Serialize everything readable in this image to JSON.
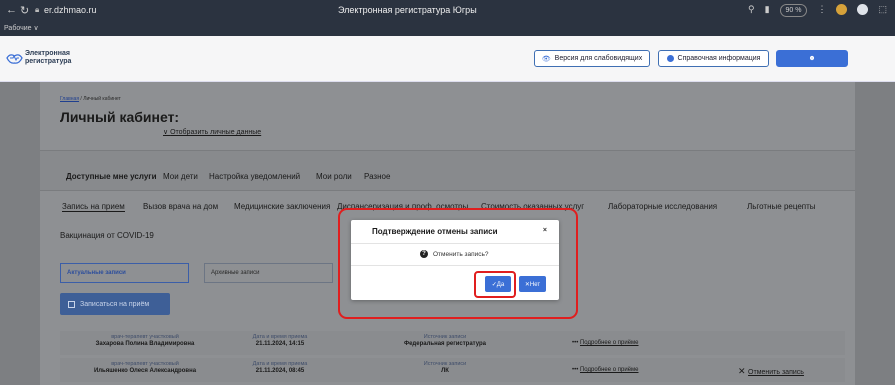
{
  "browser": {
    "back_icon": "back-arrow-icon",
    "reload_icon": "reload-icon",
    "url": "er.dzhmao.ru",
    "tab_title": "Электронная регистратура Югры",
    "zoom": "90 %",
    "bookmark_folder": "Рабочие ∨"
  },
  "header": {
    "logo_line1": "Электронная",
    "logo_line2": "регистратура",
    "low_vision_label": "Версия для слабовидящих",
    "help_label": "Справочная информация",
    "brand_color": "#3b6fd6"
  },
  "page": {
    "breadcrumb_home": "Главная",
    "breadcrumb_sep": " / ",
    "breadcrumb_current": "Личный кабинет",
    "title": "Личный кабинет:",
    "show_personal_data": "Отобразить личные данные"
  },
  "main_tabs": [
    {
      "label": "Доступные мне услуги"
    },
    {
      "label": "Мои дети"
    },
    {
      "label": "Настройка уведомлений"
    },
    {
      "label": "Мои роли"
    },
    {
      "label": "Разное"
    }
  ],
  "service_tabs": [
    {
      "label": "Запись на прием"
    },
    {
      "label": "Вызов врача на дом"
    },
    {
      "label": "Медицинские заключения"
    },
    {
      "label": "Диспансеризация и проф. осмотры"
    },
    {
      "label": "Стоимость оказанных услуг"
    },
    {
      "label": "Лабораторные исследования"
    },
    {
      "label": "Льготные рецепты"
    },
    {
      "label": "Вакцинация от COVID-19"
    }
  ],
  "appointments": {
    "active_tab": "Актуальные записи",
    "archive_tab": "Архивные записи",
    "book_button": "Записаться на приём",
    "rows": [
      {
        "specialty": "врач-терапевт участковый",
        "doctor": "Захарова Полина Владимировна",
        "datetime_label": "Дата и время приема",
        "datetime": "21.11.2024, 14:15",
        "source_label": "Источник записи",
        "source": "Федеральная регистратура",
        "more": "Подробнее о приёме",
        "cancel": ""
      },
      {
        "specialty": "врач-терапевт участковый",
        "doctor": "Ильяшенко Олеся Александровна",
        "datetime_label": "Дата и время приема",
        "datetime": "21.11.2024, 08:45",
        "source_label": "Источник записи",
        "source": "ЛК",
        "more": "Подробнее о приёме",
        "cancel": "Отменить запись"
      }
    ]
  },
  "modal": {
    "title": "Подтверждение отмены записи",
    "close": "×",
    "question_icon": "question-circle-icon",
    "question": "Отменить запись?",
    "yes": "✓Да",
    "no": "✕Нет"
  },
  "annotation_color": "#e01e1e"
}
